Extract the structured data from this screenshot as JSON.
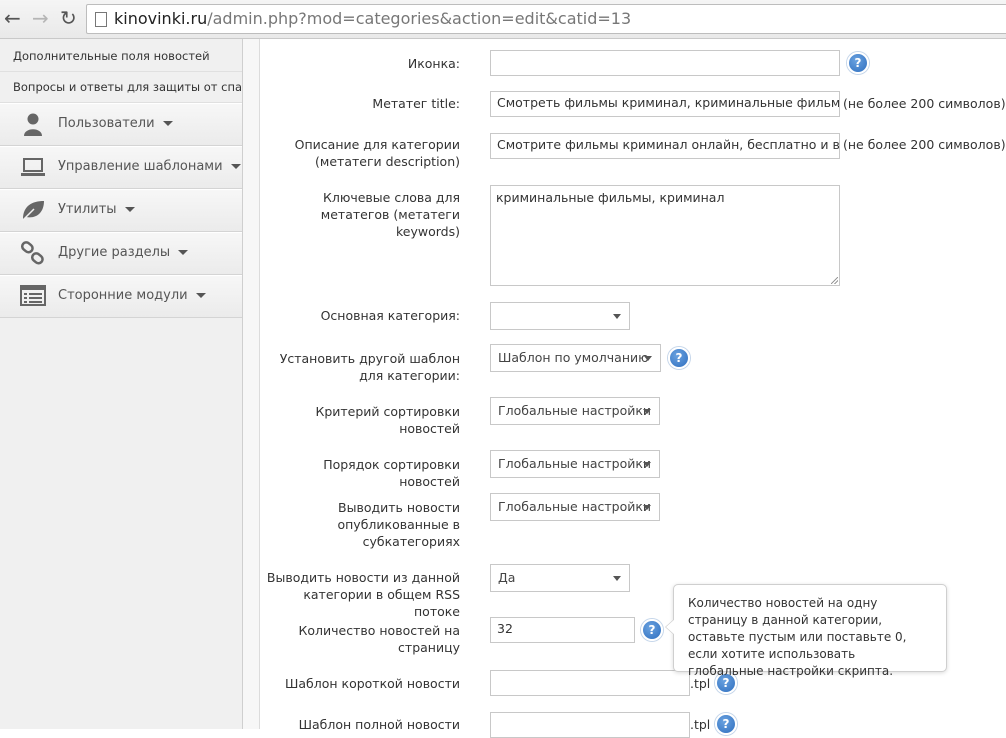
{
  "browser": {
    "host": "kinovinki.ru",
    "path": "/admin.php?mod=categories&action=edit&catid=13"
  },
  "sidebar": {
    "sub_items": [
      "Дополнительные поля новостей",
      "Вопросы и ответы для защиты от спама"
    ],
    "menu": [
      {
        "label": "Пользователи",
        "icon": "user-icon"
      },
      {
        "label": "Управление шаблонами",
        "icon": "laptop-icon"
      },
      {
        "label": "Утилиты",
        "icon": "leaf-icon"
      },
      {
        "label": "Другие разделы",
        "icon": "link-icon"
      },
      {
        "label": "Сторонние модули",
        "icon": "list-icon"
      }
    ]
  },
  "form": {
    "icon_label": "Иконка:",
    "icon_value": "",
    "meta_title_label": "Метатег title:",
    "meta_title_value": "Смотреть фильмы криминал, криминальные фильмы нові",
    "meta_title_note": "(не более 200 символов)",
    "description_label": "Описание для категории (метатеги description)",
    "description_value": "Смотрите фильмы криминал онлайн, бесплатно и в хорош",
    "description_note": "(не более 200 символов)",
    "keywords_label": "Ключевые слова для метатегов (метатеги keywords)",
    "keywords_value": "криминальные фильмы, криминал",
    "parent_category_label": "Основная категория:",
    "parent_category_value": "",
    "template_label": "Установить другой шаблон для категории:",
    "template_value": "Шаблон по умолчанию",
    "sort_criterion_label": "Критерий сортировки новостей",
    "sort_criterion_value": "Глобальные настройки",
    "sort_order_label": "Порядок сортировки новостей",
    "sort_order_value": "Глобальные настройки",
    "subcat_label": "Выводить новости опубликованные в субкатегориях",
    "subcat_value": "Глобальные настройки",
    "rss_label": "Выводить новости из данной категории в общем RSS потоке",
    "rss_value": "Да",
    "per_page_label": "Количество новостей на страницу",
    "per_page_value": "32",
    "short_tpl_label": "Шаблон короткой новости",
    "short_tpl_value": "",
    "full_tpl_label": "Шаблон полной новости",
    "full_tpl_value": "",
    "tpl_suffix": ".tpl",
    "help_glyph": "?"
  },
  "tooltip": {
    "text": "Количество новостей на одну страницу в данной категории, оставьте пустым или поставьте 0, если хотите использовать глобальные настройки скрипта."
  },
  "colors": {
    "help_blue": "#2f6fbf",
    "sidebar_bg": "#f0f0f0"
  }
}
